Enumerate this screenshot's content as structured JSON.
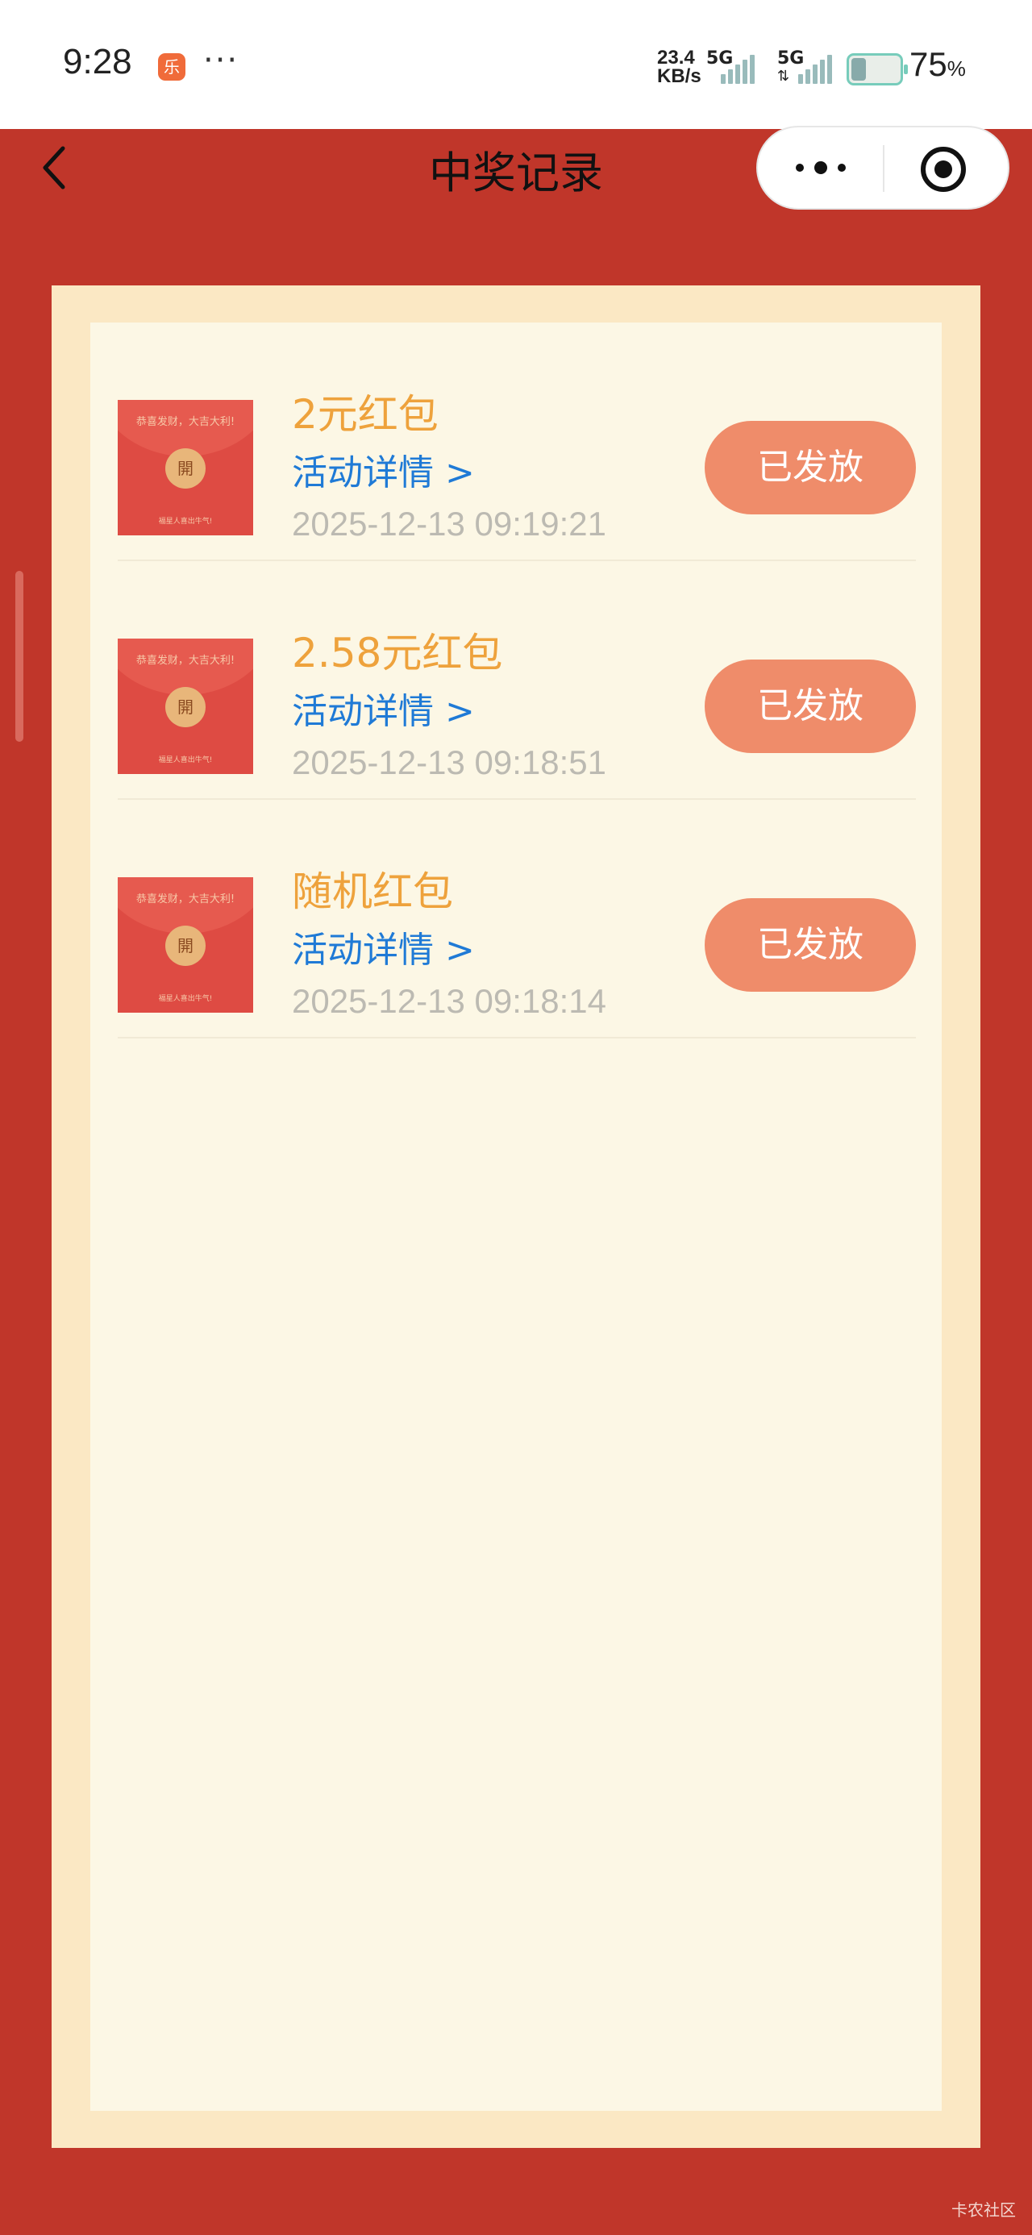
{
  "status_bar": {
    "time": "9:28",
    "app_icon": "app-notification-icon",
    "overflow": "···",
    "net_speed_value": "23.4",
    "net_speed_unit": "KB/s",
    "network_1": "5G",
    "network_2": "5G",
    "battery_percent": "75",
    "battery_unit": "%"
  },
  "nav": {
    "title": "中奖记录",
    "back_icon": "chevron-left-icon",
    "more_icon": "more-dots-icon",
    "close_icon": "target-circle-icon"
  },
  "records": [
    {
      "prize": "2元红包",
      "detail_link": "活动详情 >",
      "time": "2025-12-13 09:19:21",
      "status": "已发放"
    },
    {
      "prize": "2.58元红包",
      "detail_link": "活动详情 >",
      "time": "2025-12-13 09:18:51",
      "status": "已发放"
    },
    {
      "prize": "随机红包",
      "detail_link": "活动详情 >",
      "time": "2025-12-13 09:18:14",
      "status": "已发放"
    }
  ],
  "envelope_thumb": {
    "top_text": "恭喜发财，大吉大利!",
    "seal_text": "開",
    "bottom_text": "福星人喜出牛气!"
  },
  "watermark": "卡农社区",
  "colors": {
    "background_red": "#c0362a",
    "frame": "#fbe8c4",
    "panel": "#fcf7e5",
    "prize_text": "#eea23c",
    "link_text": "#1f7ad6",
    "status_button": "#ef8c6a"
  }
}
